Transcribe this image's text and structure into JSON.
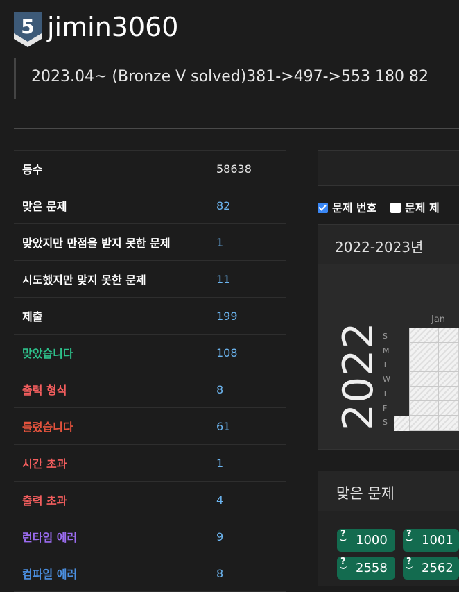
{
  "profile": {
    "tier_number": "5",
    "tier_color": "#3d5a78",
    "username": "jimin3060",
    "bio": "2023.04~ (Bronze V solved)381->497->553 180 82"
  },
  "stats": [
    {
      "label": "등수",
      "value": "58638",
      "label_color": "#ffffff",
      "plain": true
    },
    {
      "label": "맞은 문제",
      "value": "82",
      "label_color": "#ffffff"
    },
    {
      "label": "맞았지만 만점을 받지 못한 문제",
      "value": "1",
      "label_color": "#ffffff"
    },
    {
      "label": "시도했지만 맞지 못한 문제",
      "value": "11",
      "label_color": "#ffffff"
    },
    {
      "label": "제출",
      "value": "199",
      "label_color": "#ffffff"
    },
    {
      "label": "맞았습니다",
      "value": "108",
      "label_color": "#2ec18b"
    },
    {
      "label": "출력 형식",
      "value": "8",
      "label_color": "#f45e5e"
    },
    {
      "label": "틀렸습니다",
      "value": "61",
      "label_color": "#e5533d"
    },
    {
      "label": "시간 초과",
      "value": "1",
      "label_color": "#f45e5e"
    },
    {
      "label": "출력 초과",
      "value": "4",
      "label_color": "#f45e5e"
    },
    {
      "label": "런타임 에러",
      "value": "9",
      "label_color": "#9b6cf0"
    },
    {
      "label": "컴파일 에러",
      "value": "8",
      "label_color": "#4b8fe0"
    }
  ],
  "options": {
    "show_number": {
      "label": "문제 번호",
      "checked": true
    },
    "show_title": {
      "label": "문제 제",
      "checked": false
    }
  },
  "calendar": {
    "header": "2022-2023년",
    "year": "2022",
    "weekdays": [
      "S",
      "M",
      "T",
      "W",
      "T",
      "F",
      "S"
    ],
    "month": "Jan"
  },
  "solved": {
    "title": "맞은 문제",
    "problems": [
      "1000",
      "1001",
      "2558",
      "2562"
    ]
  }
}
